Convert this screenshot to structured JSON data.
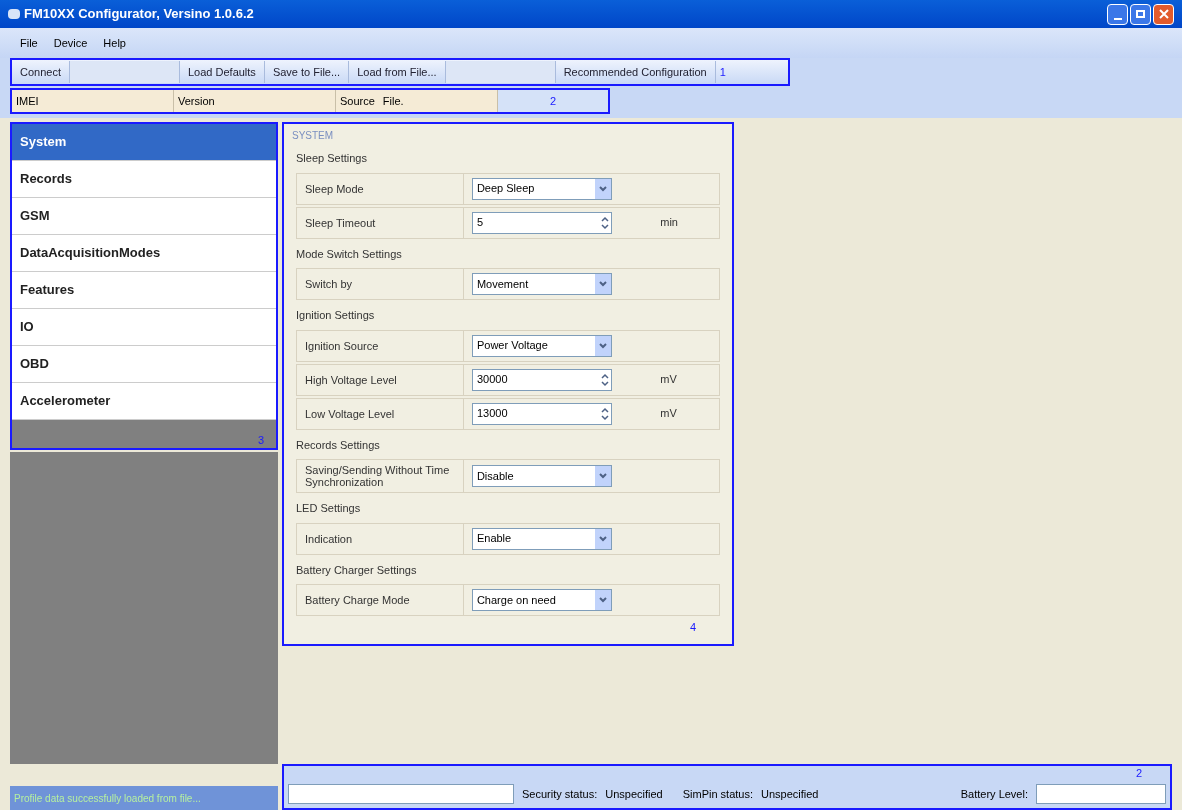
{
  "window": {
    "title": "FM10XX Configurator, Versino 1.0.6.2"
  },
  "menu": [
    "File",
    "Device",
    "Help"
  ],
  "toolbar": {
    "callout": "1",
    "buttons": [
      {
        "label": "Connect",
        "disabled": false
      },
      {
        "disabled": true
      },
      {
        "label": "Load Defaults",
        "disabled": false
      },
      {
        "label": "Save to File...",
        "disabled": false
      },
      {
        "label": "Load from File...",
        "disabled": false
      },
      {
        "disabled": true
      },
      {
        "label": "Recommended Configuration",
        "disabled": false
      }
    ]
  },
  "info_bar": {
    "callout": "2",
    "fields": [
      {
        "label": "IMEI"
      },
      {
        "label": "Version"
      },
      {
        "label": "Source",
        "value": "File."
      }
    ]
  },
  "sidebar": {
    "callout": "3",
    "items": [
      {
        "label": "System",
        "selected": true
      },
      {
        "label": "Records",
        "selected": false
      },
      {
        "label": "GSM",
        "selected": false
      },
      {
        "label": "DataAcquisitionModes",
        "selected": false
      },
      {
        "label": "Features",
        "selected": false
      },
      {
        "label": "IO",
        "selected": false
      },
      {
        "label": "OBD",
        "selected": false
      },
      {
        "label": "Accelerometer",
        "selected": false
      }
    ]
  },
  "panel": {
    "title": "SYSTEM",
    "callout": "4",
    "groups": [
      {
        "title": "Sleep Settings",
        "rows": [
          {
            "label": "Sleep Mode",
            "kind": "select",
            "value": "Deep Sleep"
          },
          {
            "label": "Sleep Timeout",
            "kind": "spin",
            "value": "5",
            "unit": "min"
          }
        ]
      },
      {
        "title": "Mode Switch Settings",
        "rows": [
          {
            "label": "Switch by",
            "kind": "select",
            "value": "Movement"
          }
        ]
      },
      {
        "title": "Ignition Settings",
        "rows": [
          {
            "label": "Ignition Source",
            "kind": "select",
            "value": "Power Voltage"
          },
          {
            "label": "High Voltage Level",
            "kind": "spin",
            "value": "30000",
            "unit": "mV"
          },
          {
            "label": "Low Voltage Level",
            "kind": "spin",
            "value": "13000",
            "unit": "mV"
          }
        ]
      },
      {
        "title": "Records Settings",
        "rows": [
          {
            "label": "Saving/Sending Without Time Synchronization",
            "kind": "select",
            "value": "Disable"
          }
        ]
      },
      {
        "title": "LED Settings",
        "rows": [
          {
            "label": "Indication",
            "kind": "select",
            "value": "Enable"
          }
        ]
      },
      {
        "title": "Battery Charger Settings",
        "rows": [
          {
            "label": "Battery Charge Mode",
            "kind": "select",
            "value": "Charge on need"
          }
        ]
      }
    ]
  },
  "status_left": "Profile data successfully loaded from file...",
  "status_bar": {
    "callout": "2",
    "security_label": "Security status:",
    "security_value": "Unspecified",
    "simpin_label": "SimPin status:",
    "simpin_value": "Unspecified",
    "battery_label": "Battery Level:"
  }
}
